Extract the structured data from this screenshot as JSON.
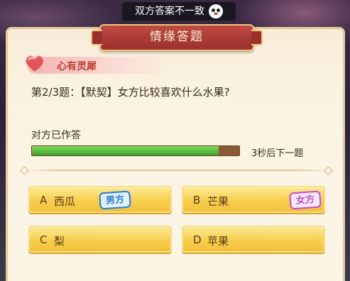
{
  "notice": {
    "text": "双方答案不一致"
  },
  "dialog": {
    "title": "情缘答题",
    "category": "心有灵犀",
    "question": "第2/3题：【默契】女方比较喜欢什么水果?",
    "status": "对方已作答",
    "progress_fraction": 0.9,
    "countdown": "3秒后下一题"
  },
  "options": [
    {
      "letter": "A",
      "text": "西瓜",
      "tag": "男方"
    },
    {
      "letter": "B",
      "text": "芒果",
      "tag": "女方"
    },
    {
      "letter": "C",
      "text": "梨"
    },
    {
      "letter": "D",
      "text": "苹果"
    }
  ],
  "colors": {
    "accent_red": "#c0392b",
    "option_gold": "#f7cf4e",
    "progress_green": "#3fa02a",
    "male_tag": "#2a7ad8",
    "female_tag": "#c14ad0"
  }
}
